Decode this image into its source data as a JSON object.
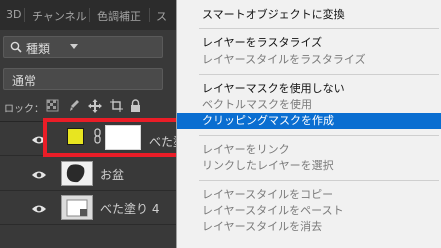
{
  "tabs": [
    "3D",
    "チャンネル",
    "色調補正",
    "ス"
  ],
  "filter": {
    "label": "種類"
  },
  "blend_mode": "通常",
  "lock_label": "ロック：",
  "layers": [
    {
      "name": "べた塗",
      "selected": false
    },
    {
      "name": "お盆"
    },
    {
      "name": "べた塗り 4"
    }
  ],
  "menu": {
    "items": [
      {
        "label": "スマートオブジェクトに変換",
        "enabled": true
      },
      {
        "label": "レイヤーをラスタライズ",
        "enabled": true
      },
      {
        "label": "レイヤースタイルをラスタライズ",
        "enabled": false
      },
      {
        "label": "レイヤーマスクを使用しない",
        "enabled": true
      },
      {
        "label": "ベクトルマスクを使用",
        "enabled": false
      },
      {
        "label": "クリッピングマスクを作成",
        "enabled": true,
        "highlighted": true
      },
      {
        "label": "レイヤーをリンク",
        "enabled": false
      },
      {
        "label": "リンクしたレイヤーを選択",
        "enabled": false
      },
      {
        "label": "レイヤースタイルをコピー",
        "enabled": false
      },
      {
        "label": "レイヤースタイルをペースト",
        "enabled": false
      },
      {
        "label": "レイヤースタイルを消去",
        "enabled": false
      }
    ]
  },
  "colors": {
    "panel_bg": "#393939",
    "menu_bg": "#f1f1f1",
    "menu_highlight": "#0a6ed1",
    "fill_swatch": "#e8e520",
    "annotation_box": "#ea1d27"
  }
}
